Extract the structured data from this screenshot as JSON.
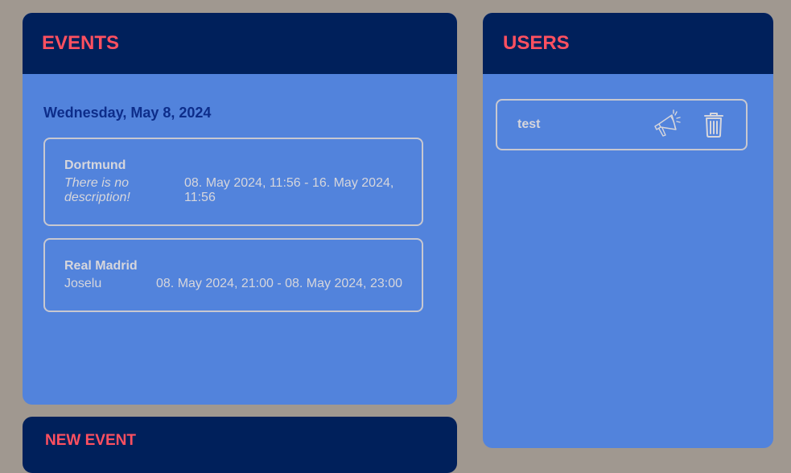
{
  "events": {
    "title": "EVENTS",
    "date": "Wednesday, May 8, 2024",
    "items": [
      {
        "name": "Dortmund",
        "description": "There is no description!",
        "time": "08. May 2024, 11:56 - 16. May 2024, 11:56"
      },
      {
        "name": "Real Madrid",
        "description": "Joselu",
        "time": "08. May 2024, 21:00 - 08. May 2024, 23:00"
      }
    ]
  },
  "users": {
    "title": "USERS",
    "items": [
      {
        "name": "test",
        "notify_icon": "megaphone-icon",
        "delete_icon": "trash-icon"
      }
    ]
  },
  "new_event": {
    "title": "NEW EVENT"
  },
  "colors": {
    "background": "#a09890",
    "header": "#00205b",
    "header_text": "#ff5060",
    "panel": "#5283dc",
    "date_text": "#0d2d8a",
    "card_text": "#d6d6dc"
  }
}
